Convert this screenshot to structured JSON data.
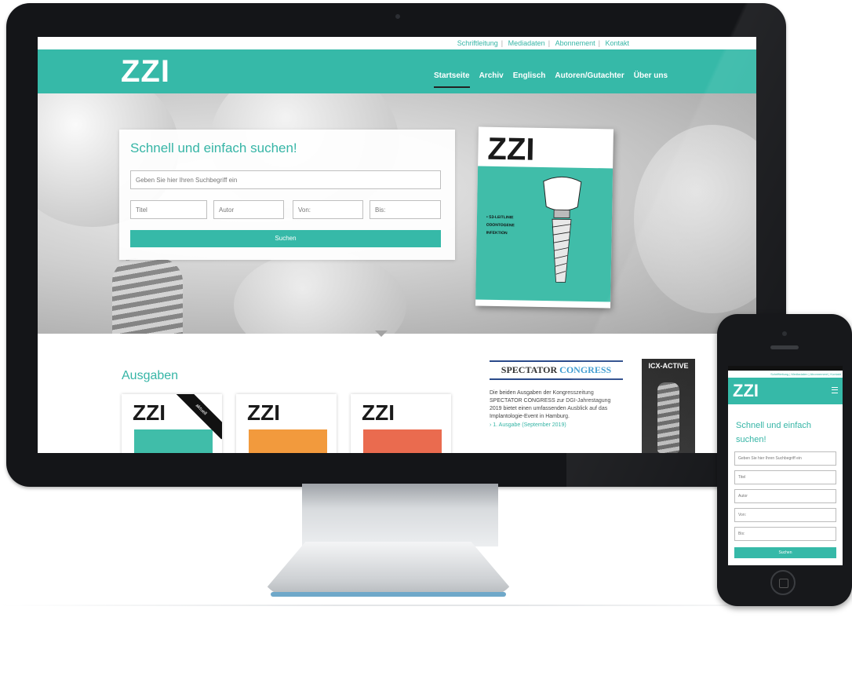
{
  "util_links": [
    "Schriftleitung",
    "Mediadaten",
    "Abonnement",
    "Kontakt"
  ],
  "brand": "ZZI",
  "nav": [
    "Startseite",
    "Archiv",
    "Englisch",
    "Autoren/Gutachter",
    "Über uns"
  ],
  "search": {
    "title": "Schnell und einfach suchen!",
    "query_placeholder": "Geben Sie hier Ihren Suchbegriff ein",
    "title_placeholder": "Titel",
    "author_placeholder": "Autor",
    "from_placeholder": "Von:",
    "to_placeholder": "Bis:",
    "button": "Suchen"
  },
  "cover": {
    "logo": "ZZI",
    "lines": [
      "• S3-LEITLINIE",
      "ODONTOGENE",
      "INFEKTION"
    ]
  },
  "sections": {
    "ausgaben": "Ausgaben",
    "ribbon": "aktuell",
    "issues": [
      {
        "logo": "ZZI",
        "color": "#40bda9"
      },
      {
        "logo": "ZZI",
        "color": "#f29a3d"
      },
      {
        "logo": "ZZI",
        "color": "#ea6b4f"
      }
    ]
  },
  "spectator": {
    "logo_a": "SPECTATOR ",
    "logo_b": "CONGRESS",
    "text": "Die beiden Ausgaben der Kongresszeitung SPECTATOR CONGRESS zur DGI-Jahrestagung 2019 bietet einen umfassenden Ausblick auf das Implantologie-Event in Hamburg.",
    "link": "› 1. Ausgabe (September 2019)"
  },
  "ad": {
    "title": "ICX-ACTIVE"
  },
  "mobile": {
    "brand": "ZZI",
    "title": "Schnell und einfach suchen!",
    "fields": [
      "Geben Sie hier Ihren Suchbegriff ein",
      "Titel",
      "Autor",
      "Von:",
      "Bis:"
    ],
    "button": "Suchen"
  },
  "colors": {
    "accent": "#36b9a8",
    "monitor": "#141518"
  }
}
